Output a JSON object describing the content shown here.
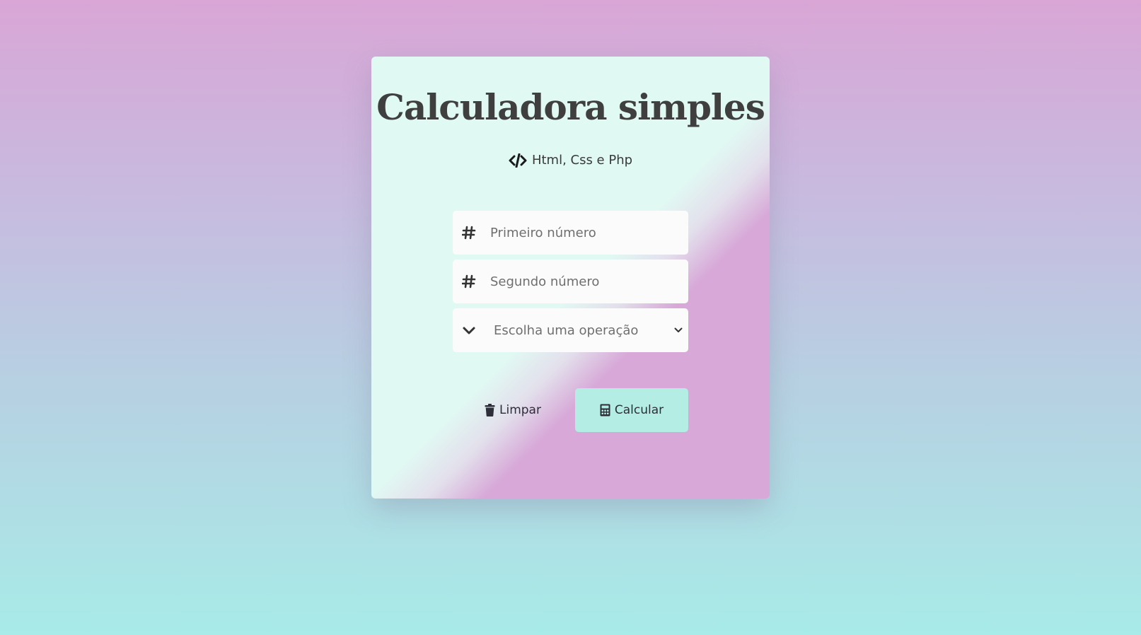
{
  "card": {
    "title": "Calculadora simples",
    "subtitle_icon": "code-icon",
    "subtitle": "Html, Css e Php"
  },
  "form": {
    "first_number": {
      "icon": "hash-icon",
      "placeholder": "Primeiro número",
      "value": ""
    },
    "second_number": {
      "icon": "hash-icon",
      "placeholder": "Segundo número",
      "value": ""
    },
    "operation": {
      "icon": "chevron-down-icon",
      "selected": "Escolha uma operação"
    }
  },
  "buttons": {
    "clear": {
      "icon": "trash-icon",
      "label": "Limpar"
    },
    "calculate": {
      "icon": "calculator-icon",
      "label": "Calcular"
    }
  },
  "colors": {
    "calculate_button": "#b3ede3",
    "card_mint": "#e1f9f3",
    "card_pink": "#d7a8d8",
    "title_text": "#3f3f3f"
  }
}
